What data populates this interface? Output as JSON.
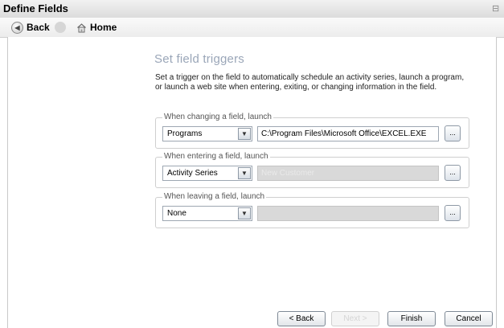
{
  "window": {
    "title": "Define Fields"
  },
  "nav": {
    "back_label": "Back",
    "home_label": "Home"
  },
  "page": {
    "heading": "Set field triggers",
    "description": "Set a trigger on the field to automatically schedule an activity series, launch a program, or launch a web site when entering, exiting, or changing information in the field."
  },
  "groups": {
    "changing": {
      "legend": "When changing a field, launch",
      "selected": "Programs",
      "path": "C:\\Program Files\\Microsoft Office\\EXCEL.EXE",
      "browse_label": "..."
    },
    "entering": {
      "legend": "When entering a field, launch",
      "selected": "Activity Series",
      "path": "New Customer",
      "browse_label": "..."
    },
    "leaving": {
      "legend": "When leaving a field, launch",
      "selected": "None",
      "path": "",
      "browse_label": "..."
    }
  },
  "footer": {
    "back_label": "< Back",
    "next_label": "Next >",
    "finish_label": "Finish",
    "cancel_label": "Cancel"
  },
  "icons": {
    "back": "back-arrow-icon",
    "home": "home-icon",
    "dropdown": "chevron-down-icon"
  }
}
